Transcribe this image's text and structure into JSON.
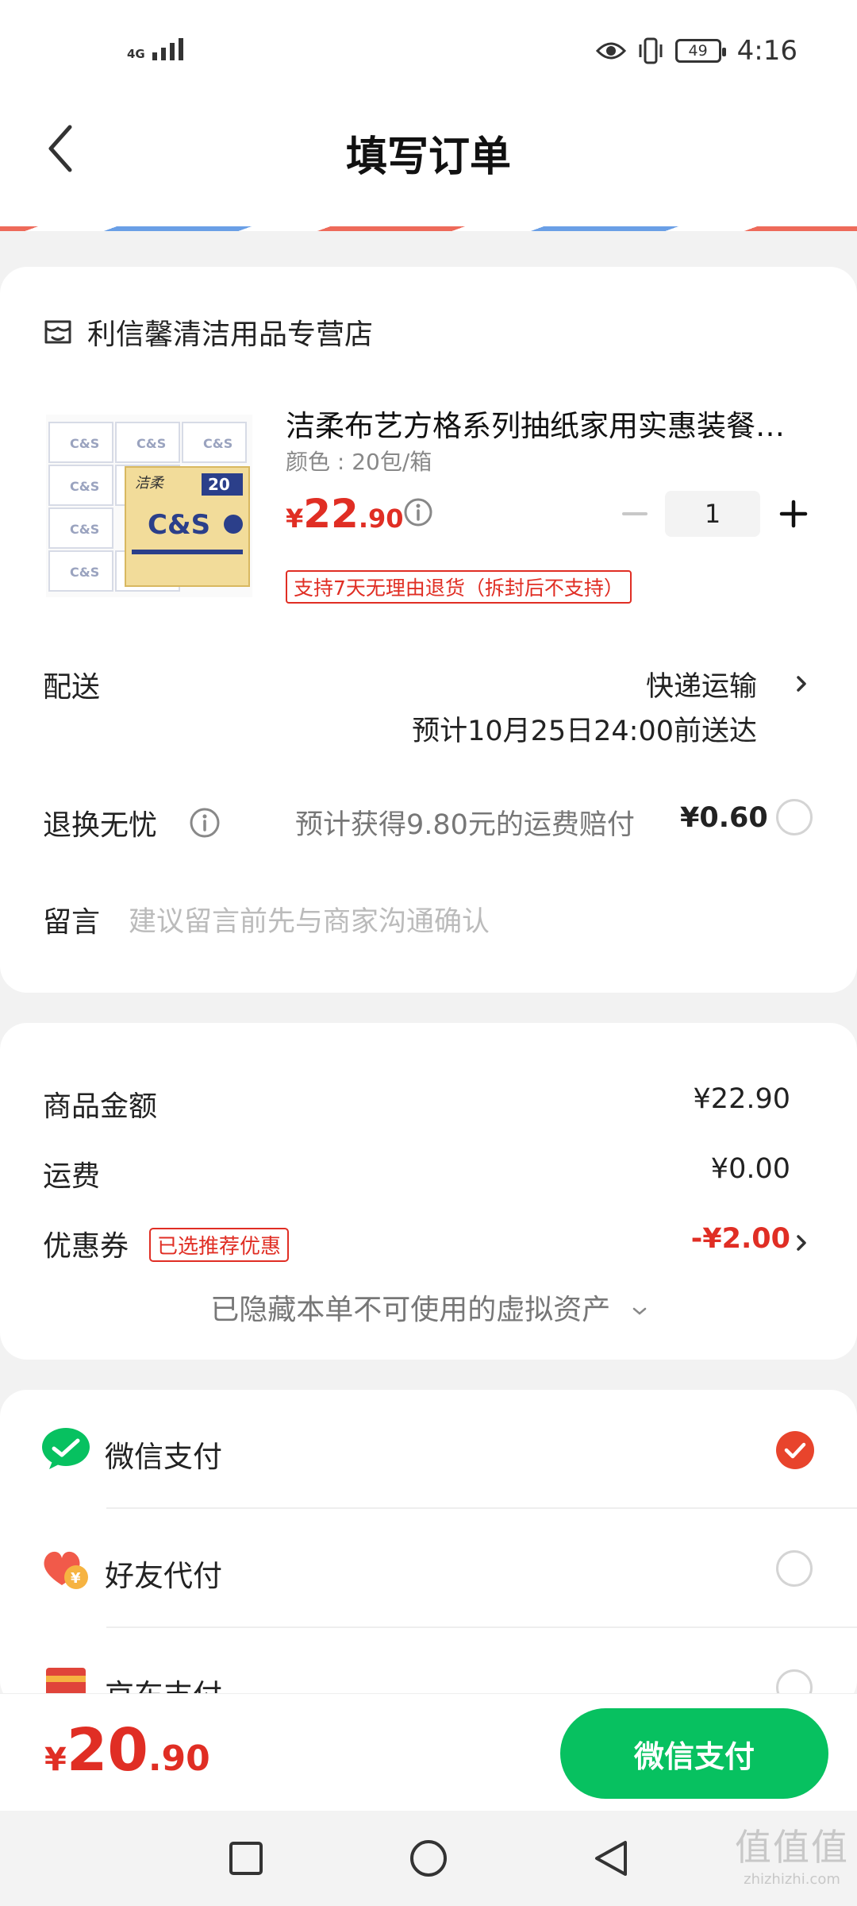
{
  "status_bar": {
    "network": "4G",
    "battery": "49",
    "time": "4:16"
  },
  "header": {
    "title": "填写订单"
  },
  "store": {
    "name": "利信馨清洁用品专营店"
  },
  "product": {
    "title": "洁柔布艺方格系列抽纸家用实惠装餐巾纸",
    "spec": "颜色 : 20包/箱",
    "price_symbol": "¥",
    "price_int": "22",
    "price_dec": ".90",
    "quantity": "1",
    "return_tag": "支持7天无理由退货（拆封后不支持）",
    "image_text": {
      "brand": "C&S",
      "count": "20",
      "logo": "洁柔"
    }
  },
  "delivery": {
    "label": "配送",
    "method": "快递运输",
    "eta": "预计10月25日24:00前送达"
  },
  "insurance": {
    "label": "退换无忧",
    "desc": "预计获得9.80元的运费赔付",
    "price": "¥0.60"
  },
  "message": {
    "label": "留言",
    "placeholder": "建议留言前先与商家沟通确认"
  },
  "summary": {
    "goods_label": "商品金额",
    "goods_value": "¥22.90",
    "shipping_label": "运费",
    "shipping_value": "¥0.00",
    "coupon_label": "优惠券",
    "coupon_tag": "已选推荐优惠",
    "coupon_value": "-¥2.00",
    "hidden_assets": "已隐藏本单不可使用的虚拟资产"
  },
  "payment": {
    "options": [
      {
        "label": "微信支付",
        "selected": true
      },
      {
        "label": "好友代付",
        "selected": false
      },
      {
        "label": "京东支付",
        "selected": false
      }
    ]
  },
  "footer": {
    "total_symbol": "¥",
    "total_int": "20",
    "total_dec": ".90",
    "pay_button": "微信支付"
  },
  "watermark": {
    "logo": "值值值",
    "url": "zhizhizhi.com"
  },
  "colors": {
    "accent_red": "#e02e24",
    "wechat_green": "#07c160",
    "check_orange": "#e8442c"
  }
}
